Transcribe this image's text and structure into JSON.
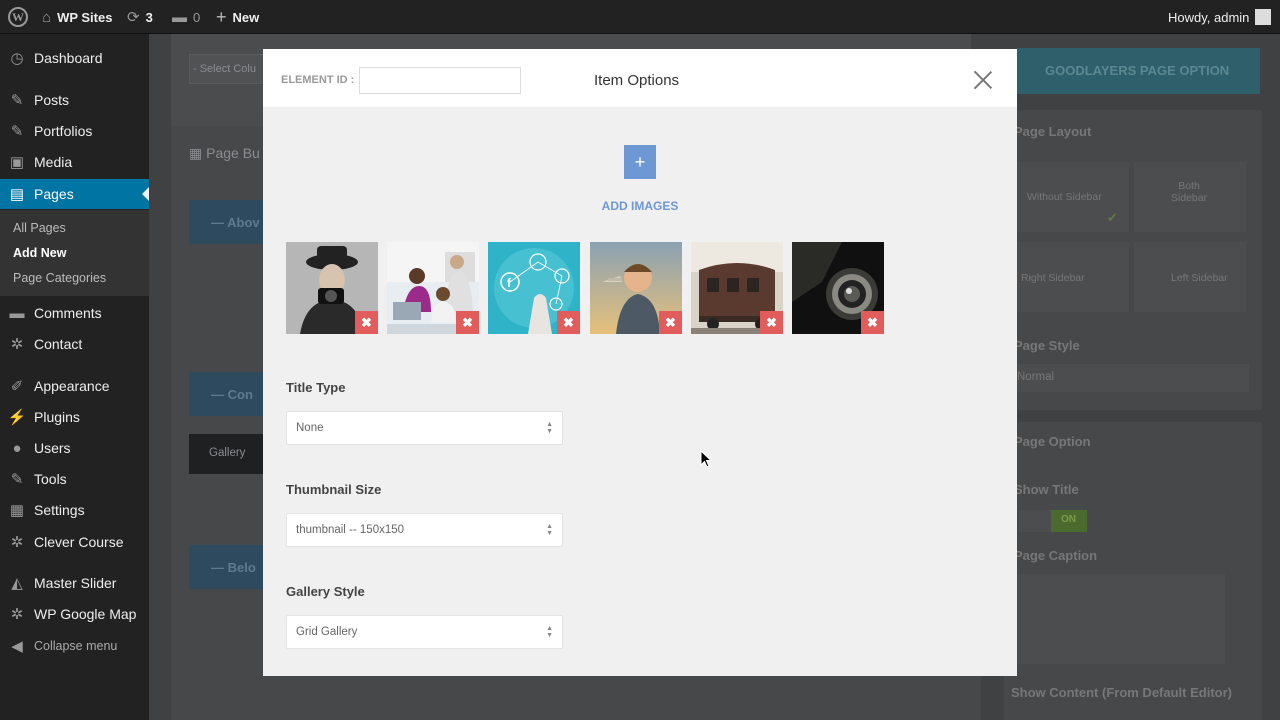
{
  "admin_bar": {
    "site_name": "WP Sites",
    "updates_count": "3",
    "comments_count": "0",
    "new_label": "New",
    "greeting": "Howdy, admin"
  },
  "sidebar": {
    "items": [
      {
        "label": "Dashboard",
        "icon": "dashboard-icon",
        "glyph": "◷"
      },
      {
        "label": "Posts",
        "icon": "pin-icon",
        "glyph": "✎"
      },
      {
        "label": "Portfolios",
        "icon": "pin-icon",
        "glyph": "✎"
      },
      {
        "label": "Media",
        "icon": "media-icon",
        "glyph": "▣"
      },
      {
        "label": "Pages",
        "icon": "pages-icon",
        "glyph": "▤"
      },
      {
        "label": "Comments",
        "icon": "comment-icon",
        "glyph": "▬"
      },
      {
        "label": "Contact",
        "icon": "gear-icon",
        "glyph": "✲"
      },
      {
        "label": "Appearance",
        "icon": "brush-icon",
        "glyph": "✐"
      },
      {
        "label": "Plugins",
        "icon": "plug-icon",
        "glyph": "⚡"
      },
      {
        "label": "Users",
        "icon": "user-icon",
        "glyph": "●"
      },
      {
        "label": "Tools",
        "icon": "wrench-icon",
        "glyph": "✎"
      },
      {
        "label": "Settings",
        "icon": "settings-icon",
        "glyph": "▦"
      },
      {
        "label": "Clever Course",
        "icon": "gear-icon",
        "glyph": "✲"
      },
      {
        "label": "Master Slider",
        "icon": "slider-icon",
        "glyph": "◭"
      },
      {
        "label": "WP Google Map",
        "icon": "gear-icon",
        "glyph": "✲"
      }
    ],
    "submenu": [
      "All Pages",
      "Add New",
      "Page Categories"
    ],
    "collapse_label": "Collapse menu"
  },
  "background": {
    "select_column": "- Select Colu",
    "page_builder": "Page Bu",
    "section_above": "Abov",
    "section_content": "Con",
    "section_below": "Belo",
    "gallery_item": "Gallery",
    "page_option_button": "GOODLAYERS PAGE OPTION",
    "page_layout": "Page Layout",
    "layout_without": "Without Sidebar",
    "layout_both": "Both Sidebar",
    "layout_right": "Right Sidebar",
    "layout_left": "Left Sidebar",
    "page_style": "Page Style",
    "page_style_value": "Normal",
    "page_option": "Page Option",
    "show_title": "Show Title",
    "toggle_on": "ON",
    "page_caption": "Page Caption",
    "show_content": "Show Content (From Default Editor)"
  },
  "modal": {
    "element_id_label": "ELEMENT ID :",
    "element_id_value": "",
    "title": "Item Options",
    "add_images_label": "ADD IMAGES",
    "thumbnails": [
      "woman-camera",
      "office-team",
      "social-network",
      "boy-airplane",
      "train-car",
      "vintage-camera"
    ],
    "fields": {
      "title_type": {
        "label": "Title Type",
        "value": "None"
      },
      "thumbnail_size": {
        "label": "Thumbnail Size",
        "value": "thumbnail -- 150x150"
      },
      "gallery_style": {
        "label": "Gallery Style",
        "value": "Grid Gallery"
      }
    }
  },
  "colors": {
    "accent": "#6d98d4",
    "delete": "#e25c5c",
    "wp_active": "#0074a2"
  }
}
